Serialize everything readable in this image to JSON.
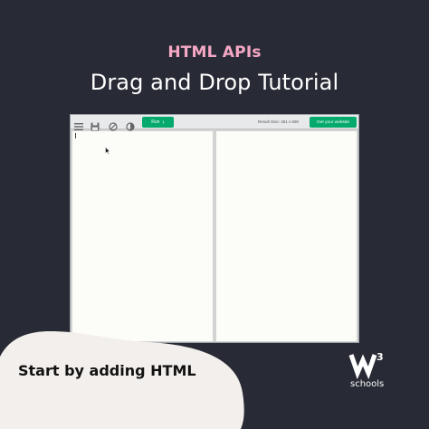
{
  "header": {
    "kicker": "HTML APIs",
    "title": "Drag and Drop Tutorial"
  },
  "toolbar": {
    "icons": [
      "menu-icon",
      "save-icon",
      "orientation-icon",
      "theme-contrast-icon"
    ],
    "run_label": "Run",
    "run_icon": "chevron-right-icon",
    "result_size": "Result Size: 461 x 690",
    "get_website_label": "Get your website"
  },
  "footer": {
    "cta": "Start by adding HTML",
    "logo_sup": "3",
    "logo_text": "schools"
  },
  "colors": {
    "background": "#282a35",
    "kicker": "#f5a8c5",
    "accent_green": "#04aa6d",
    "blob": "#f3efec"
  }
}
